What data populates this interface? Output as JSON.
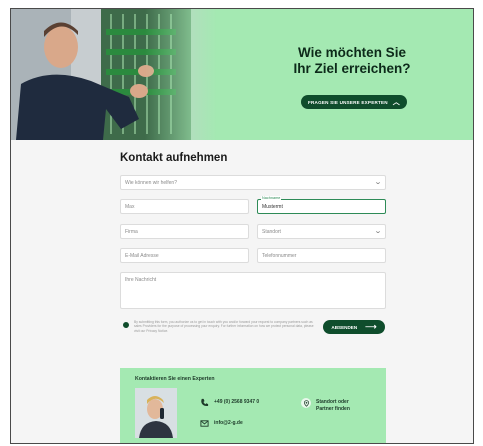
{
  "hero": {
    "title_line1": "Wie möchten Sie",
    "title_line2": "Ihr Ziel erreichen?",
    "button_label": "FRAGEN SIE UNSERE EXPERTEN"
  },
  "form": {
    "title": "Kontakt aufnehmen",
    "topic_placeholder": "Wie können wir helfen?",
    "first_name_value": "Max",
    "last_name_label": "Nachname",
    "last_name_value": "Mustermt",
    "company_placeholder": "Firma",
    "location_placeholder": "Standort",
    "email_placeholder": "E-Mail Adresse",
    "phone_placeholder": "Telefonnummer",
    "message_placeholder": "Ihre Nachricht",
    "consent_text": "By submitting this form, you authorize us to get in touch with you and/or forward your request to company partners such as sales Providers for the purpose of processing your enquiry. For further information on how we protect personal data, please visit our Privacy Notice.",
    "send_label": "ABSENDEN"
  },
  "contact": {
    "title": "Kontaktieren Sie einen Experten",
    "phone": "+49 (0) 2568 9347 0",
    "email": "info@2-g.de",
    "location_line1": "Standort oder",
    "location_line2": "Partner finden"
  },
  "colors": {
    "accent_light": "#a4e9b2",
    "accent_dark": "#0f4d2c"
  },
  "icons": [
    "chevron-up-icon",
    "chevron-down-icon",
    "arrow-right-icon",
    "phone-icon",
    "mail-icon",
    "location-pin-icon"
  ]
}
